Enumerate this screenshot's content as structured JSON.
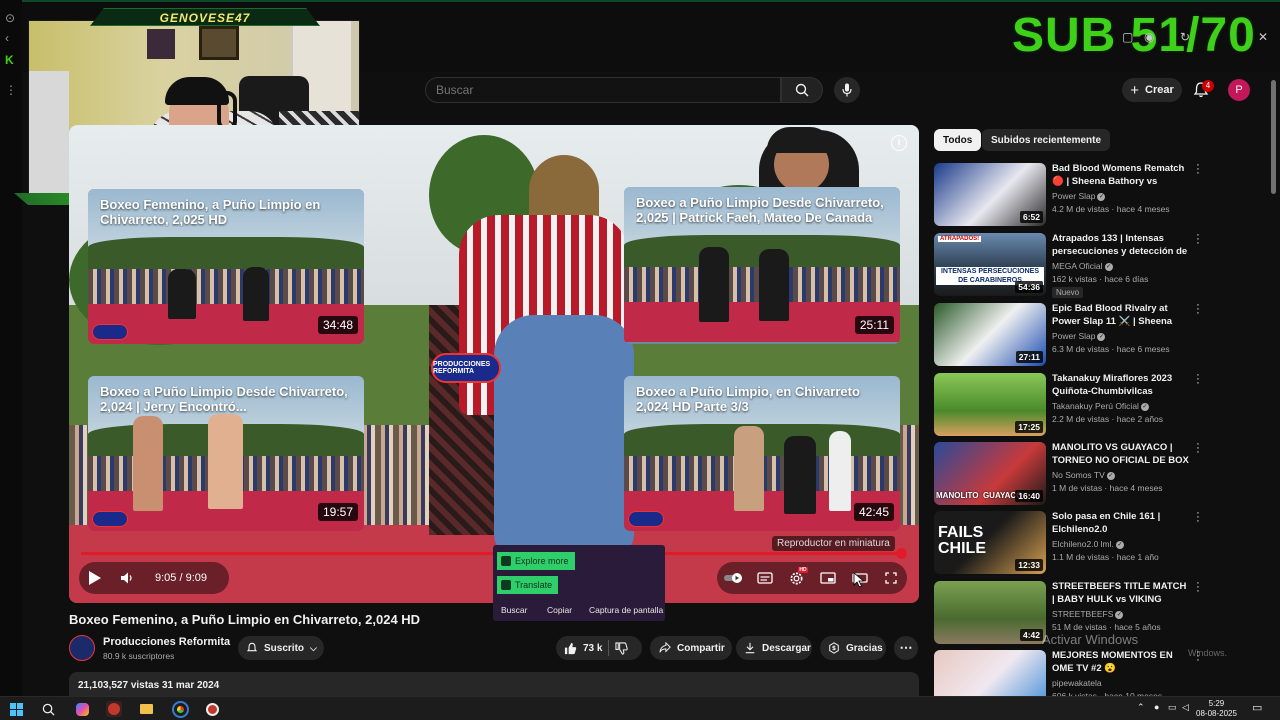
{
  "overlay": {
    "streamer_name": "GENOVESE47",
    "sub_goal": "SUB 51/70"
  },
  "header": {
    "search_placeholder": "Buscar",
    "create_label": "Crear",
    "notifications_count": "4",
    "avatar_letter": "P"
  },
  "player": {
    "endcards": [
      {
        "title": "Boxeo Femenino, a Puño Limpio en Chivarreto, 2,025 HD",
        "duration": "34:48"
      },
      {
        "title": "Boxeo a Puño Limpio Desde Chivarreto, 2,025 | Patrick Faeh, Mateo De Canada",
        "duration": "25:11"
      },
      {
        "title": "Boxeo a Puño Limpio Desde Chivarreto, 2,024 | Jerry Encontró...",
        "duration": "19:57"
      },
      {
        "title": "Boxeo a Puño Limpio, en Chivarreto 2,024 HD Parte 3/3",
        "duration": "42:45"
      }
    ],
    "logo_text": "PRODUCCIONES REFORMITA",
    "time_display": "9:05 / 9:09",
    "progress_fraction": 0.993,
    "miniplayer_tooltip": "Reproductor en miniatura",
    "hd_badge": "HD"
  },
  "context_menu": {
    "explore": "Explore more",
    "translate": "Translate",
    "search": "Buscar",
    "copy": "Copiar",
    "screenshot": "Captura de pantalla"
  },
  "video": {
    "title": "Boxeo Femenino, a Puño Limpio en Chivarreto, 2,024 HD",
    "channel": "Producciones  Reformita",
    "subscribers": "80.9 k suscriptores",
    "subscribed_label": "Suscrito",
    "likes": "73 k",
    "share_label": "Compartir",
    "download_label": "Descargar",
    "thanks_label": "Gracias",
    "views_date": "21,103,527 vistas  31 mar 2024"
  },
  "sidebar": {
    "chips": [
      "Todos",
      "Subidos recientemente"
    ],
    "recommendations": [
      {
        "title": "Bad Blood Womens Rematch 🔴 | Sheena Bathory vs Jackie...",
        "channel": "Power Slap",
        "verified": true,
        "meta": "4.2 M de vistas · hace 4 meses",
        "duration": "6:52",
        "badge": ""
      },
      {
        "title": "Atrapados 133 | Intensas persecuciones y detección de ...",
        "channel": "MEGA Oficial",
        "verified": true,
        "meta": "162 k vistas · hace 6 días",
        "duration": "54:36",
        "badge": "Nuevo"
      },
      {
        "title": "Epic Bad Blood Rivalry at Power Slap 11 ⚔️ | Sheena Bathory v...",
        "channel": "Power Slap",
        "verified": true,
        "meta": "6.3 M de vistas · hace 6 meses",
        "duration": "27:11",
        "badge": ""
      },
      {
        "title": "Takanakuy Miraflores 2023 Quiñota-Chumbivilcas",
        "channel": "Takanakuy Perú Oficial",
        "verified": true,
        "meta": "2.2 M de vistas · hace 2 años",
        "duration": "17:25",
        "badge": ""
      },
      {
        "title": "MANOLITO VS GUAYACO | TORNEO NO OFICIAL DE BOX -...",
        "channel": "No Somos TV",
        "verified": true,
        "meta": "1 M de vistas · hace 4 meses",
        "duration": "16:40",
        "badge": ""
      },
      {
        "title": "Solo pasa en Chile 161 | Elchileno2.0",
        "channel": "Elchileno2.0 lml.",
        "verified": true,
        "meta": "1.1 M de vistas · hace 1 año",
        "duration": "12:33",
        "badge": ""
      },
      {
        "title": "STREETBEEFS TITLE MATCH | BABY HULK vs VIKING",
        "channel": "STREETBEEFS",
        "verified": true,
        "meta": "51 M de vistas · hace 5 años",
        "duration": "4:42",
        "badge": ""
      },
      {
        "title": "MEJORES MOMENTOS EN OME TV #2 😮",
        "channel": "pipewakatela",
        "verified": false,
        "meta": "606 k vistas · hace 10 meses",
        "duration": "",
        "badge": ""
      }
    ],
    "thumb_texts": [
      "INTENSAS PERSECUCIONES DE CARABINEROS",
      "FAILS CHILE",
      "MANOLITO  GUAYACO",
      "ATRAPADOS!"
    ]
  },
  "watermark": {
    "line1": "Activar Windows",
    "line2": "Windows."
  },
  "taskbar": {
    "time": "5:29",
    "date": "08-08-2025"
  },
  "colors": {
    "accent_red": "#e21b2b",
    "sub_green": "#3fd11a",
    "background": "#0f0f0f"
  }
}
